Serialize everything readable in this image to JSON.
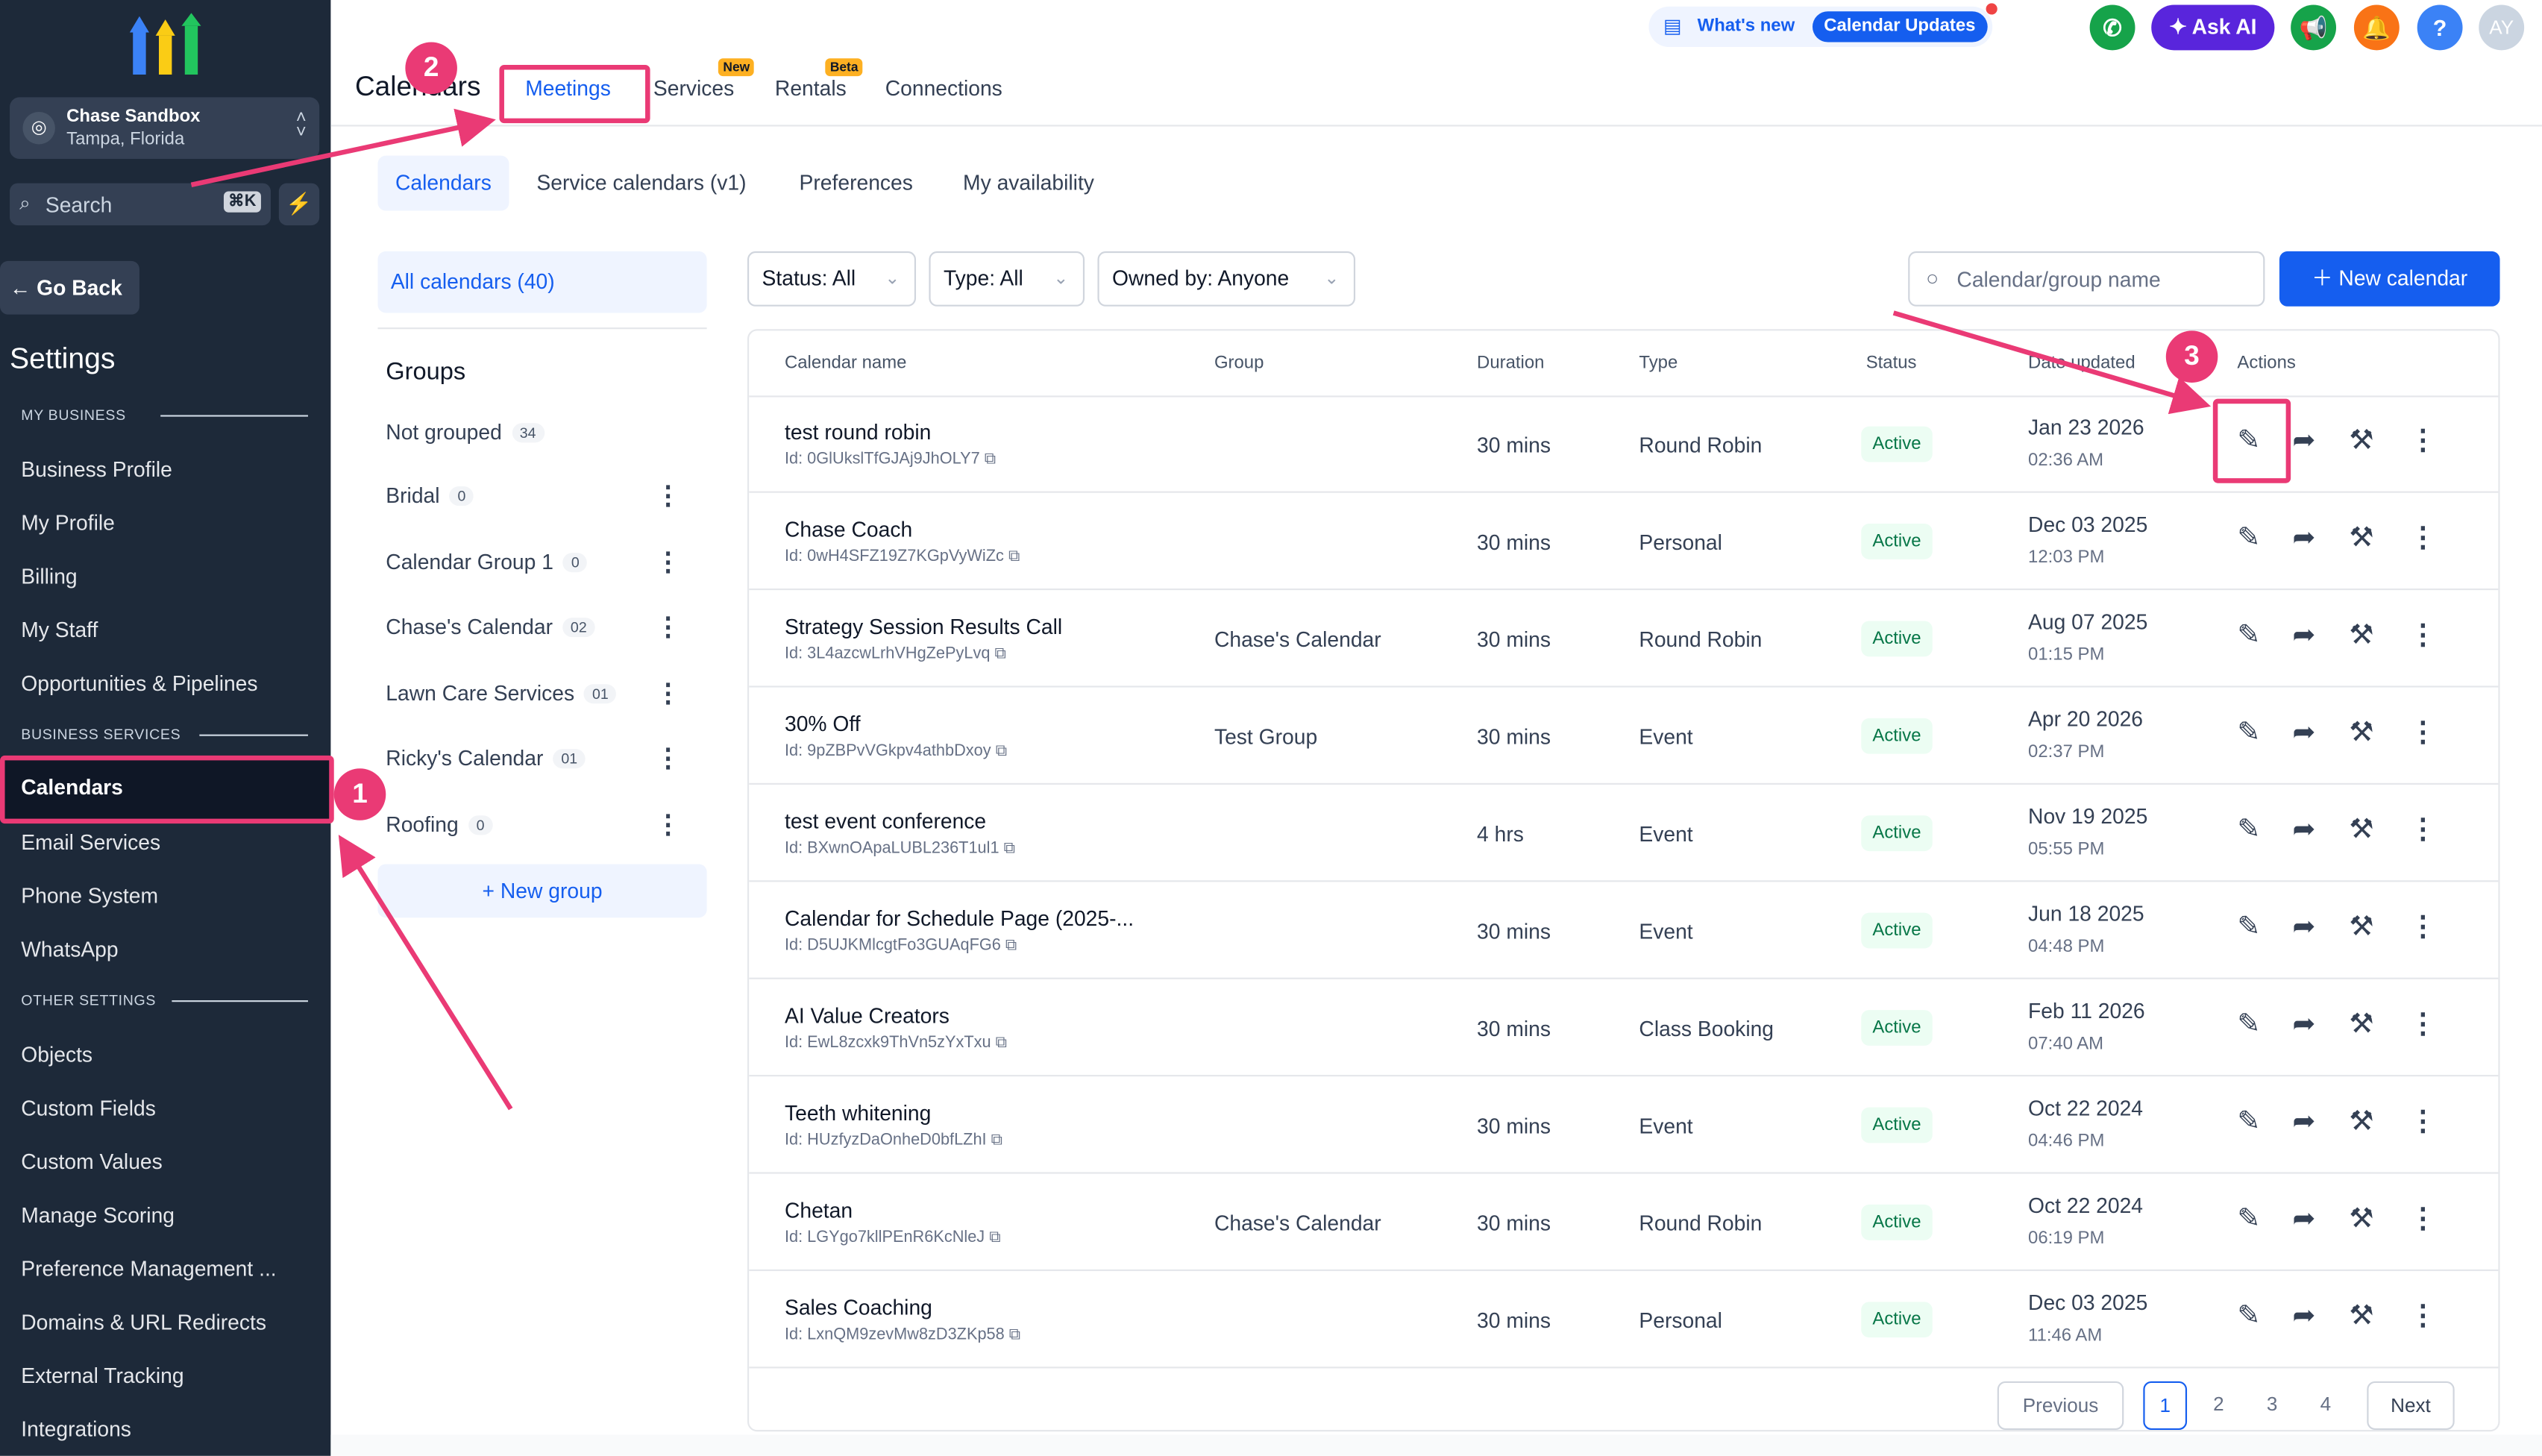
{
  "sidebar": {
    "account_name": "Chase Sandbox",
    "account_location": "Tampa, Florida",
    "search_placeholder": "Search",
    "search_shortcut": "⌘K",
    "go_back": "Go Back",
    "settings_title": "Settings",
    "section_my_business": "MY BUSINESS",
    "section_business_services": "BUSINESS SERVICES",
    "section_other_settings": "OTHER SETTINGS",
    "my_business_items": [
      "Business Profile",
      "My Profile",
      "Billing",
      "My Staff",
      "Opportunities & Pipelines"
    ],
    "business_services_items": [
      "Calendars",
      "Email Services",
      "Phone System",
      "WhatsApp"
    ],
    "other_settings_items": [
      "Objects",
      "Custom Fields",
      "Custom Values",
      "Manage Scoring",
      "Preference Management ...",
      "Domains & URL Redirects",
      "External Tracking",
      "Integrations"
    ],
    "active_item": "Calendars"
  },
  "header": {
    "page_title": "Calendars",
    "tabs": [
      {
        "label": "Meetings",
        "badge": ""
      },
      {
        "label": "Services",
        "badge": "New"
      },
      {
        "label": "Rentals",
        "badge": "Beta"
      },
      {
        "label": "Connections",
        "badge": ""
      }
    ],
    "whats_new": "What's new",
    "calendar_updates": "Calendar Updates",
    "ask_ai": "Ask AI",
    "help": "?",
    "avatar_initials": "AY"
  },
  "subtabs": [
    "Calendars",
    "Service calendars (v1)",
    "Preferences",
    "My availability"
  ],
  "groups_panel": {
    "all_calendars": "All calendars (40)",
    "title": "Groups",
    "items": [
      {
        "name": "Not grouped",
        "count": "34"
      },
      {
        "name": "Bridal",
        "count": "0"
      },
      {
        "name": "Calendar Group 1",
        "count": "0"
      },
      {
        "name": "Chase's Calendar",
        "count": "02"
      },
      {
        "name": "Lawn Care Services",
        "count": "01"
      },
      {
        "name": "Ricky's Calendar",
        "count": "01"
      },
      {
        "name": "Roofing",
        "count": "0"
      }
    ],
    "new_group": "New group"
  },
  "filters": {
    "status": "Status: All",
    "type": "Type: All",
    "owned_by": "Owned by: Anyone",
    "search_placeholder": "Calendar/group name",
    "new_calendar": "New calendar"
  },
  "table": {
    "columns": [
      "Calendar name",
      "Group",
      "Duration",
      "Type",
      "Status",
      "Date updated",
      "Actions"
    ],
    "rows": [
      {
        "name": "test round robin",
        "id": "Id: 0GlUkslTfGJAj9JhOLY7",
        "group": "",
        "duration": "30 mins",
        "type": "Round Robin",
        "status": "Active",
        "date": "Jan 23 2026",
        "time": "02:36 AM"
      },
      {
        "name": "Chase Coach",
        "id": "Id: 0wH4SFZ19Z7KGpVyWiZc",
        "group": "",
        "duration": "30 mins",
        "type": "Personal",
        "status": "Active",
        "date": "Dec 03 2025",
        "time": "12:03 PM"
      },
      {
        "name": "Strategy Session Results Call",
        "id": "Id: 3L4azcwLrhVHgZePyLvq",
        "group": "Chase's Calendar",
        "duration": "30 mins",
        "type": "Round Robin",
        "status": "Active",
        "date": "Aug 07 2025",
        "time": "01:15 PM"
      },
      {
        "name": "30% Off",
        "id": "Id: 9pZBPvVGkpv4athbDxoy",
        "group": "Test Group",
        "duration": "30 mins",
        "type": "Event",
        "status": "Active",
        "date": "Apr 20 2026",
        "time": "02:37 PM"
      },
      {
        "name": "test event conference",
        "id": "Id: BXwnOApaLUBL236T1ul1",
        "group": "",
        "duration": "4 hrs",
        "type": "Event",
        "status": "Active",
        "date": "Nov 19 2025",
        "time": "05:55 PM"
      },
      {
        "name": "Calendar for Schedule Page (2025-...",
        "id": "Id: D5UJKMlcgtFo3GUAqFG6",
        "group": "",
        "duration": "30 mins",
        "type": "Event",
        "status": "Active",
        "date": "Jun 18 2025",
        "time": "04:48 PM"
      },
      {
        "name": "AI Value Creators",
        "id": "Id: EwL8zcxk9ThVn5zYxTxu",
        "group": "",
        "duration": "30 mins",
        "type": "Class Booking",
        "status": "Active",
        "date": "Feb 11 2026",
        "time": "07:40 AM"
      },
      {
        "name": "Teeth whitening",
        "id": "Id: HUzfyzDaOnheD0bfLZhI",
        "group": "",
        "duration": "30 mins",
        "type": "Event",
        "status": "Active",
        "date": "Oct 22 2024",
        "time": "04:46 PM"
      },
      {
        "name": "Chetan",
        "id": "Id: LGYgo7kllPEnR6KcNleJ",
        "group": "Chase's Calendar",
        "duration": "30 mins",
        "type": "Round Robin",
        "status": "Active",
        "date": "Oct 22 2024",
        "time": "06:19 PM"
      },
      {
        "name": "Sales Coaching",
        "id": "Id: LxnQM9zevMw8zD3ZKp58",
        "group": "",
        "duration": "30 mins",
        "type": "Personal",
        "status": "Active",
        "date": "Dec 03 2025",
        "time": "11:46 AM"
      }
    ]
  },
  "pagination": {
    "previous": "Previous",
    "pages": [
      "1",
      "2",
      "3",
      "4"
    ],
    "next": "Next",
    "current": "1"
  },
  "annotations": [
    "1",
    "2",
    "3"
  ],
  "colors": {
    "accent": "#155eef",
    "sidebar": "#1d2939",
    "highlight": "#ea3a75",
    "active_badge": "#067647"
  }
}
